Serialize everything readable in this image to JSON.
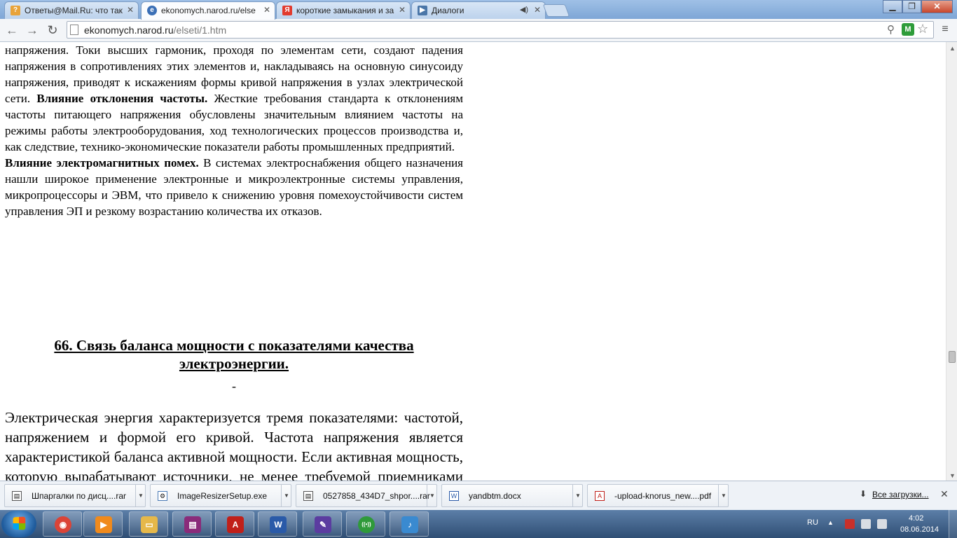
{
  "browser": {
    "tabs": [
      {
        "title": "Ответы@Mail.Ru: что так",
        "favicon": "?"
      },
      {
        "title": "ekonomych.narod.ru/else",
        "favicon": "e"
      },
      {
        "title": "короткие замыкания и за",
        "favicon": "Я"
      },
      {
        "title": "Диалоги",
        "favicon": "▶"
      }
    ],
    "address": {
      "domain": "ekonomych.narod.ru",
      "path": "/elseti/1.htm"
    }
  },
  "article": {
    "para1": {
      "text": "напряжения. Токи высших гармоник, проходя по элементам сети, создают падения напряжения в сопротивлениях этих элементов и, накладываясь на основную синусоиду напряжения, приводят к искажениям формы кривой напряжения в узлах электрической сети. ",
      "bold": "Влияние отклонения частоты.",
      "text2": " Жесткие требования стандарта к отклонениям частоты питающего напряжения обусловлены значительным влиянием частоты на режимы работы электрооборудования, ход технологических процессов производства и, как следствие, технико-экономические показатели работы промышленных предприятий."
    },
    "para2": {
      "bold": "Влияние электромагнитных помех.",
      "text": " В системах электроснабжения общего назначения нашли широкое применение электронные и микроэлектронные системы управления, микропроцессоры и ЭВМ, что привело к снижению уровня помехоустойчивости систем управления ЭП и резкому возрастанию количества их отказов."
    },
    "heading": "66. Связь баланса мощности с показателями качества электроэнергии.",
    "dash": "-",
    "para3": "Электрическая энергия характеризуется тремя показателями: частотой, напряжением и формой его кривой. Частота напряжения является характеристикой баланса активной мощности. Если активная мощность, которую вырабатывают источники, не менее требуемой приемниками электрической"
  },
  "downloads": {
    "items": [
      {
        "name": "Шпаргалки по дисц....rar"
      },
      {
        "name": "ImageResizerSetup.exe"
      },
      {
        "name": "0527858_434D7_shpor....rar"
      },
      {
        "name": "yandbtm.docx"
      },
      {
        "name": "-upload-knorus_new....pdf"
      }
    ],
    "show_all": "Все загрузки..."
  },
  "taskbar": {
    "lang": "RU",
    "time": "4:02",
    "date": "08.06.2014",
    "apps": [
      {
        "name": "chrome",
        "color": "#db4437",
        "glyph": "◉"
      },
      {
        "name": "media-player",
        "color": "#f08a1c",
        "glyph": "▶"
      },
      {
        "name": "explorer",
        "color": "#e6b84a",
        "glyph": "▭"
      },
      {
        "name": "winrar",
        "color": "#8a2b7a",
        "glyph": "▤"
      },
      {
        "name": "acrobat",
        "color": "#c0201a",
        "glyph": "A"
      },
      {
        "name": "word",
        "color": "#2a5aa8",
        "glyph": "W"
      },
      {
        "name": "app-feather",
        "color": "#5b3ca0",
        "glyph": "✎"
      },
      {
        "name": "app-radio",
        "color": "#2f9a3a",
        "glyph": "((•))"
      },
      {
        "name": "app-music",
        "color": "#3a8ad0",
        "glyph": "♪"
      }
    ]
  }
}
